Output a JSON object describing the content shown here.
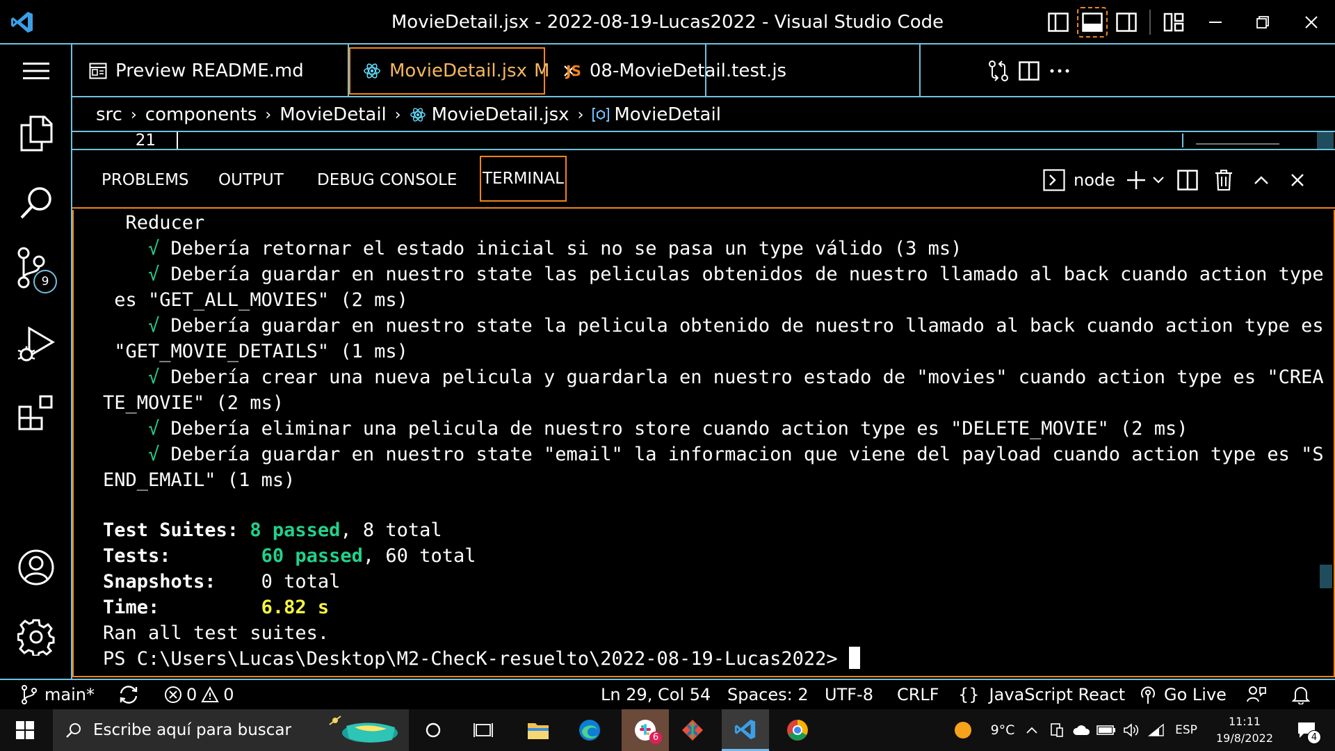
{
  "window": {
    "title": "MovieDetail.jsx - 2022-08-19-Lucas2022 - Visual Studio Code"
  },
  "tabs": [
    {
      "label": "Preview README.md",
      "icon": "preview-icon"
    },
    {
      "label": "MovieDetail.jsx",
      "badge": "M",
      "icon": "react-icon"
    },
    {
      "label": "08-MovieDetail.test.js",
      "icon_text": "JS"
    }
  ],
  "breadcrumb": [
    "src",
    "components",
    "MovieDetail",
    "MovieDetail.jsx",
    "MovieDetail"
  ],
  "editor": {
    "line_number": "21"
  },
  "panel": {
    "tabs": [
      "PROBLEMS",
      "OUTPUT",
      "DEBUG CONSOLE",
      "TERMINAL"
    ],
    "terminal_name": "node"
  },
  "terminal": {
    "lines": [
      {
        "indent": "  ",
        "text": "Reducer"
      },
      {
        "indent": "    ",
        "check": "√",
        "text": " Debería retornar el estado inicial si no se pasa un type válido (3 ms)"
      },
      {
        "indent": "    ",
        "check": "√",
        "text": " Debería guardar en nuestro state las peliculas obtenidos de nuestro llamado al back cuando action type"
      },
      {
        "indent": " ",
        "text": "es \"GET_ALL_MOVIES\" (2 ms)"
      },
      {
        "indent": "    ",
        "check": "√",
        "text": " Debería guardar en nuestro state la pelicula obtenido de nuestro llamado al back cuando action type es"
      },
      {
        "indent": " ",
        "text": "\"GET_MOVIE_DETAILS\" (1 ms)"
      },
      {
        "indent": "    ",
        "check": "√",
        "text": " Debería crear una nueva pelicula y guardarla en nuestro estado de \"movies\" cuando action type es \"CREA"
      },
      {
        "indent": "",
        "text": "TE_MOVIE\" (2 ms)"
      },
      {
        "indent": "    ",
        "check": "√",
        "text": " Debería eliminar una pelicula de nuestro store cuando action type es \"DELETE_MOVIE\" (2 ms)"
      },
      {
        "indent": "    ",
        "check": "√",
        "text": " Debería guardar en nuestro state \"email\" la informacion que viene del payload cuando action type es \"S"
      },
      {
        "indent": "",
        "text": "END_EMAIL\" (1 ms)"
      }
    ],
    "summary": {
      "suites_label": "Test Suites:",
      "suites_passed": "8 passed",
      "suites_total": ", 8 total",
      "tests_label": "Tests:",
      "tests_passed": "60 passed",
      "tests_total": ", 60 total",
      "snapshots_label": "Snapshots:",
      "snapshots_value": "0 total",
      "time_label": "Time:",
      "time_value": "6.82 s",
      "ran": "Ran all test suites.",
      "prompt": "PS C:\\Users\\Lucas\\Desktop\\M2-ChecK-resuelto\\2022-08-19-Lucas2022> "
    }
  },
  "activity": {
    "scm_badge": "9"
  },
  "statusbar": {
    "branch": "main*",
    "errors": "0",
    "warnings": "0",
    "position": "Ln 29, Col 54",
    "spaces": "Spaces: 2",
    "encoding": "UTF-8",
    "eol": "CRLF",
    "language_icon": "{}",
    "language": "JavaScript React",
    "golive": "Go Live"
  },
  "taskbar": {
    "search_placeholder": "Escribe aquí para buscar",
    "slack_badge": "6",
    "weather": "9°C",
    "lang": "ESP",
    "time": "11:11",
    "date": "19/8/2022",
    "notification_count": "4"
  },
  "colors": {
    "contrast_border": "#6fc3df",
    "active_border": "#f38518",
    "green": "#23d18b",
    "yellow": "#f5f543",
    "react_blue": "#61dafb",
    "js_orange": "#f38518"
  }
}
